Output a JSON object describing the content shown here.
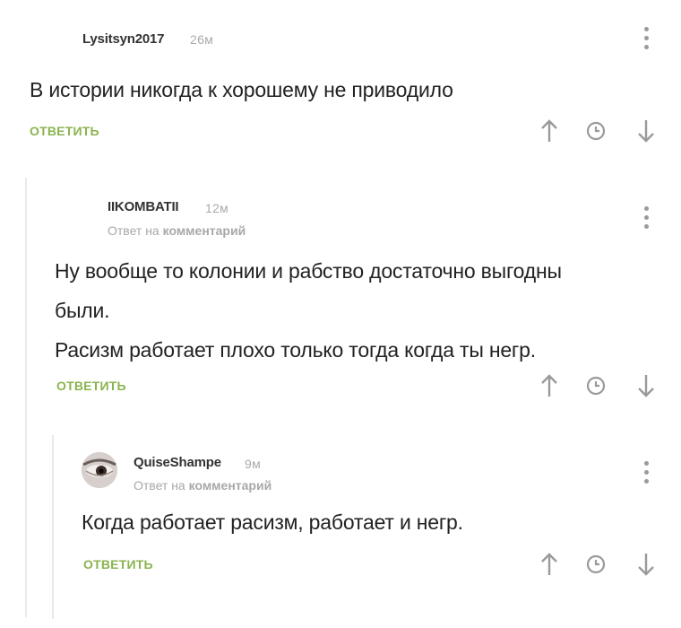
{
  "comments": [
    {
      "author": "Lysitsyn2017",
      "time": "26м",
      "reply_to_prefix": "",
      "reply_to_link": "",
      "text": [
        "В истории никогда к хорошему не приводило"
      ],
      "reply_label": "ОТВЕТИТЬ"
    },
    {
      "author": "IIKOMBATII",
      "time": "12м",
      "reply_to_prefix": "Ответ на",
      "reply_to_link": "комментарий",
      "text": [
        "Ну вообще то колонии и рабство достаточно выгодны",
        "были.",
        "Расизм работает плохо только тогда когда ты негр."
      ],
      "reply_label": "ОТВЕТИТЬ"
    },
    {
      "author": "QuiseShampe",
      "time": "9м",
      "reply_to_prefix": "Ответ на",
      "reply_to_link": "комментарий",
      "text": [
        "Когда работает расизм, работает и негр."
      ],
      "reply_label": "ОТВЕТИТЬ"
    }
  ],
  "icons": {
    "menu": "more-vertical-icon",
    "upvote": "arrow-up-icon",
    "history": "clock-icon",
    "downvote": "arrow-down-icon"
  },
  "colors": {
    "accent": "#8ab44e",
    "icon": "#9a9a9a",
    "thread_line": "#e9e9e9"
  }
}
